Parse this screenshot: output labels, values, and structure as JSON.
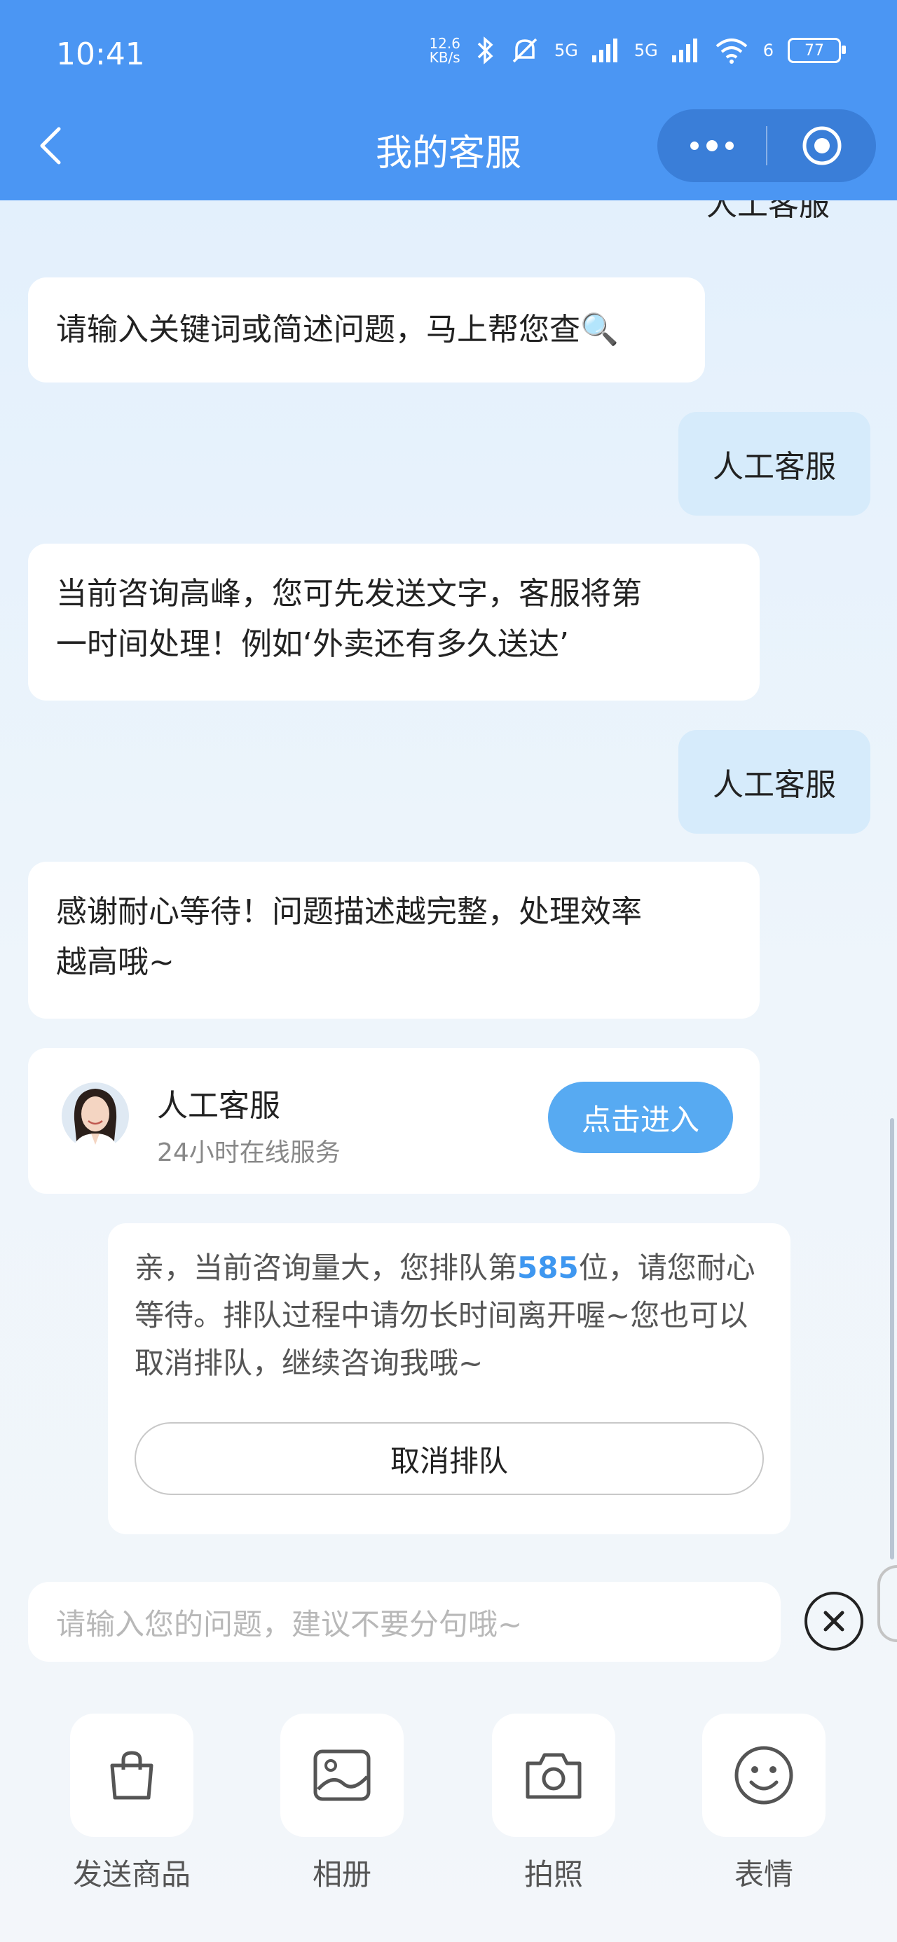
{
  "status_bar": {
    "time": "10:41",
    "net_speed": "12.6",
    "net_speed_unit": "KB/s",
    "signal1": "5G",
    "signal2": "5G",
    "wifi_num": "6",
    "battery": "77"
  },
  "nav": {
    "title": "我的客服"
  },
  "chat": {
    "cut_off_text": "人工客服",
    "msg1": "请输入关键词或简述问题，马上帮您查🔍",
    "me1": "人工客服",
    "msg2_line1": "当前咨询高峰，您可先发送文字，客服将第",
    "msg2_line2": "一时间处理！例如‘外卖还有多久送达’",
    "me2": "人工客服",
    "msg3_line1": "感谢耐心等待！问题描述越完整，处理效率",
    "msg3_line2": "越高哦~"
  },
  "agent_card": {
    "name": "人工客服",
    "subtitle": "24小时在线服务",
    "button": "点击进入"
  },
  "queue": {
    "text_before": "亲，当前咨询量大，您排队第",
    "position": "585",
    "text_after": "位，请您耐心等待。排队过程中请勿长时间离开喔~您也可以取消排队，继续咨询我哦~",
    "cancel_button": "取消排队"
  },
  "input": {
    "placeholder": "请输入您的问题，建议不要分句哦~"
  },
  "toolbar": {
    "items": [
      {
        "label": "发送商品",
        "icon": "shopping-bag-icon"
      },
      {
        "label": "相册",
        "icon": "image-icon"
      },
      {
        "label": "拍照",
        "icon": "camera-icon"
      },
      {
        "label": "表情",
        "icon": "smiley-icon"
      }
    ]
  },
  "colors": {
    "header": "#4b96f3",
    "accent": "#57aaf2",
    "queue_number": "#3e97f0",
    "user_bubble": "#d6ebfb"
  }
}
